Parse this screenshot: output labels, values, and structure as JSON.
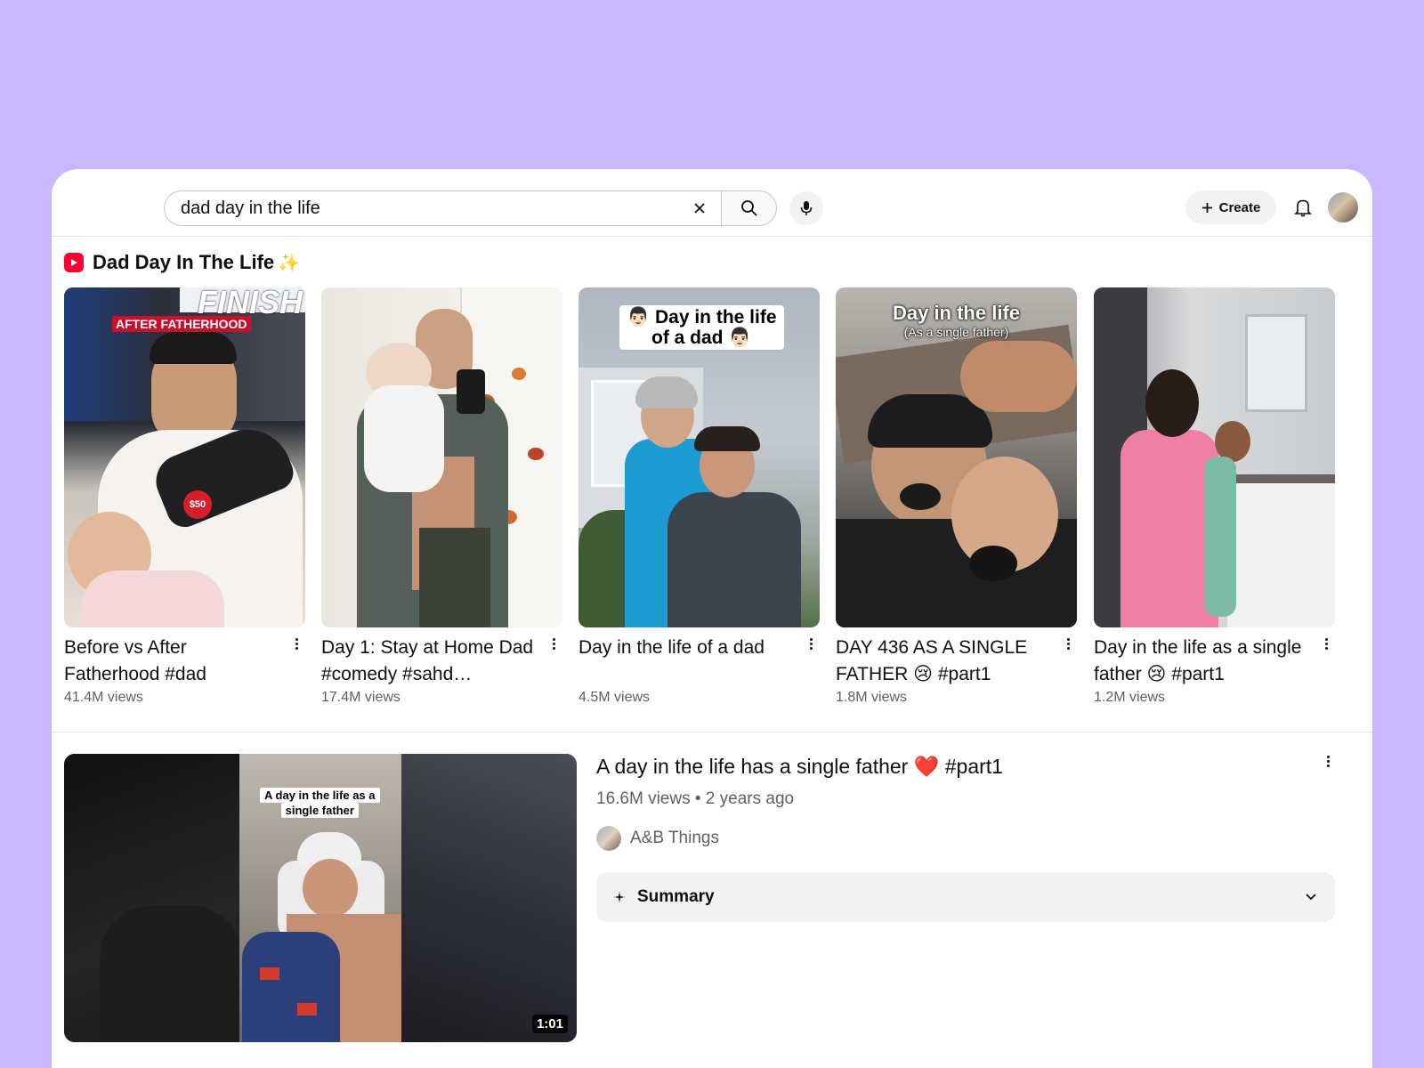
{
  "search": {
    "value": "dad day in the life"
  },
  "header": {
    "create_label": "Create"
  },
  "shelf": {
    "title": "Dad Day In The Life",
    "sparkle": "✨",
    "shorts": [
      {
        "title": "Before vs After Fatherhood #dad",
        "views": "41.4M views",
        "overlay": "AFTER FATHERHOOD",
        "overlay_top": "FINISH",
        "badge": "$50"
      },
      {
        "title": "Day 1: Stay at Home Dad #comedy #sahd…",
        "views": "17.4M views"
      },
      {
        "title": "Day in the life of a dad",
        "views": "4.5M views",
        "overlay_line1": "👨🏻 Day in the life",
        "overlay_line2": "of a dad 👨🏻"
      },
      {
        "title": "DAY 436 AS A SINGLE FATHER 😢  #part1",
        "views": "1.8M views",
        "overlay_line1": "Day in the life",
        "overlay_line2": "(As a single father)"
      },
      {
        "title": "Day in the life as a single father 😢  #part1",
        "views": "1.2M views"
      }
    ]
  },
  "video": {
    "title": "A day in the life has a single father ❤️  #part1",
    "meta": "16.6M views • 2 years ago",
    "channel": "A&B Things",
    "duration": "1:01",
    "thumb_caption_line1": "A day in the life as a",
    "thumb_caption_line2": "single father",
    "summary_label": "Summary"
  },
  "colors": {
    "brand": "#ff0033",
    "background": "#c9b8fb",
    "secondary_text": "#606060"
  },
  "icons": [
    "clear-icon",
    "search-icon",
    "mic-icon",
    "plus-icon",
    "bell-icon",
    "shorts-icon",
    "more-vertical-icon",
    "sparkle-icon",
    "chevron-down-icon"
  ]
}
